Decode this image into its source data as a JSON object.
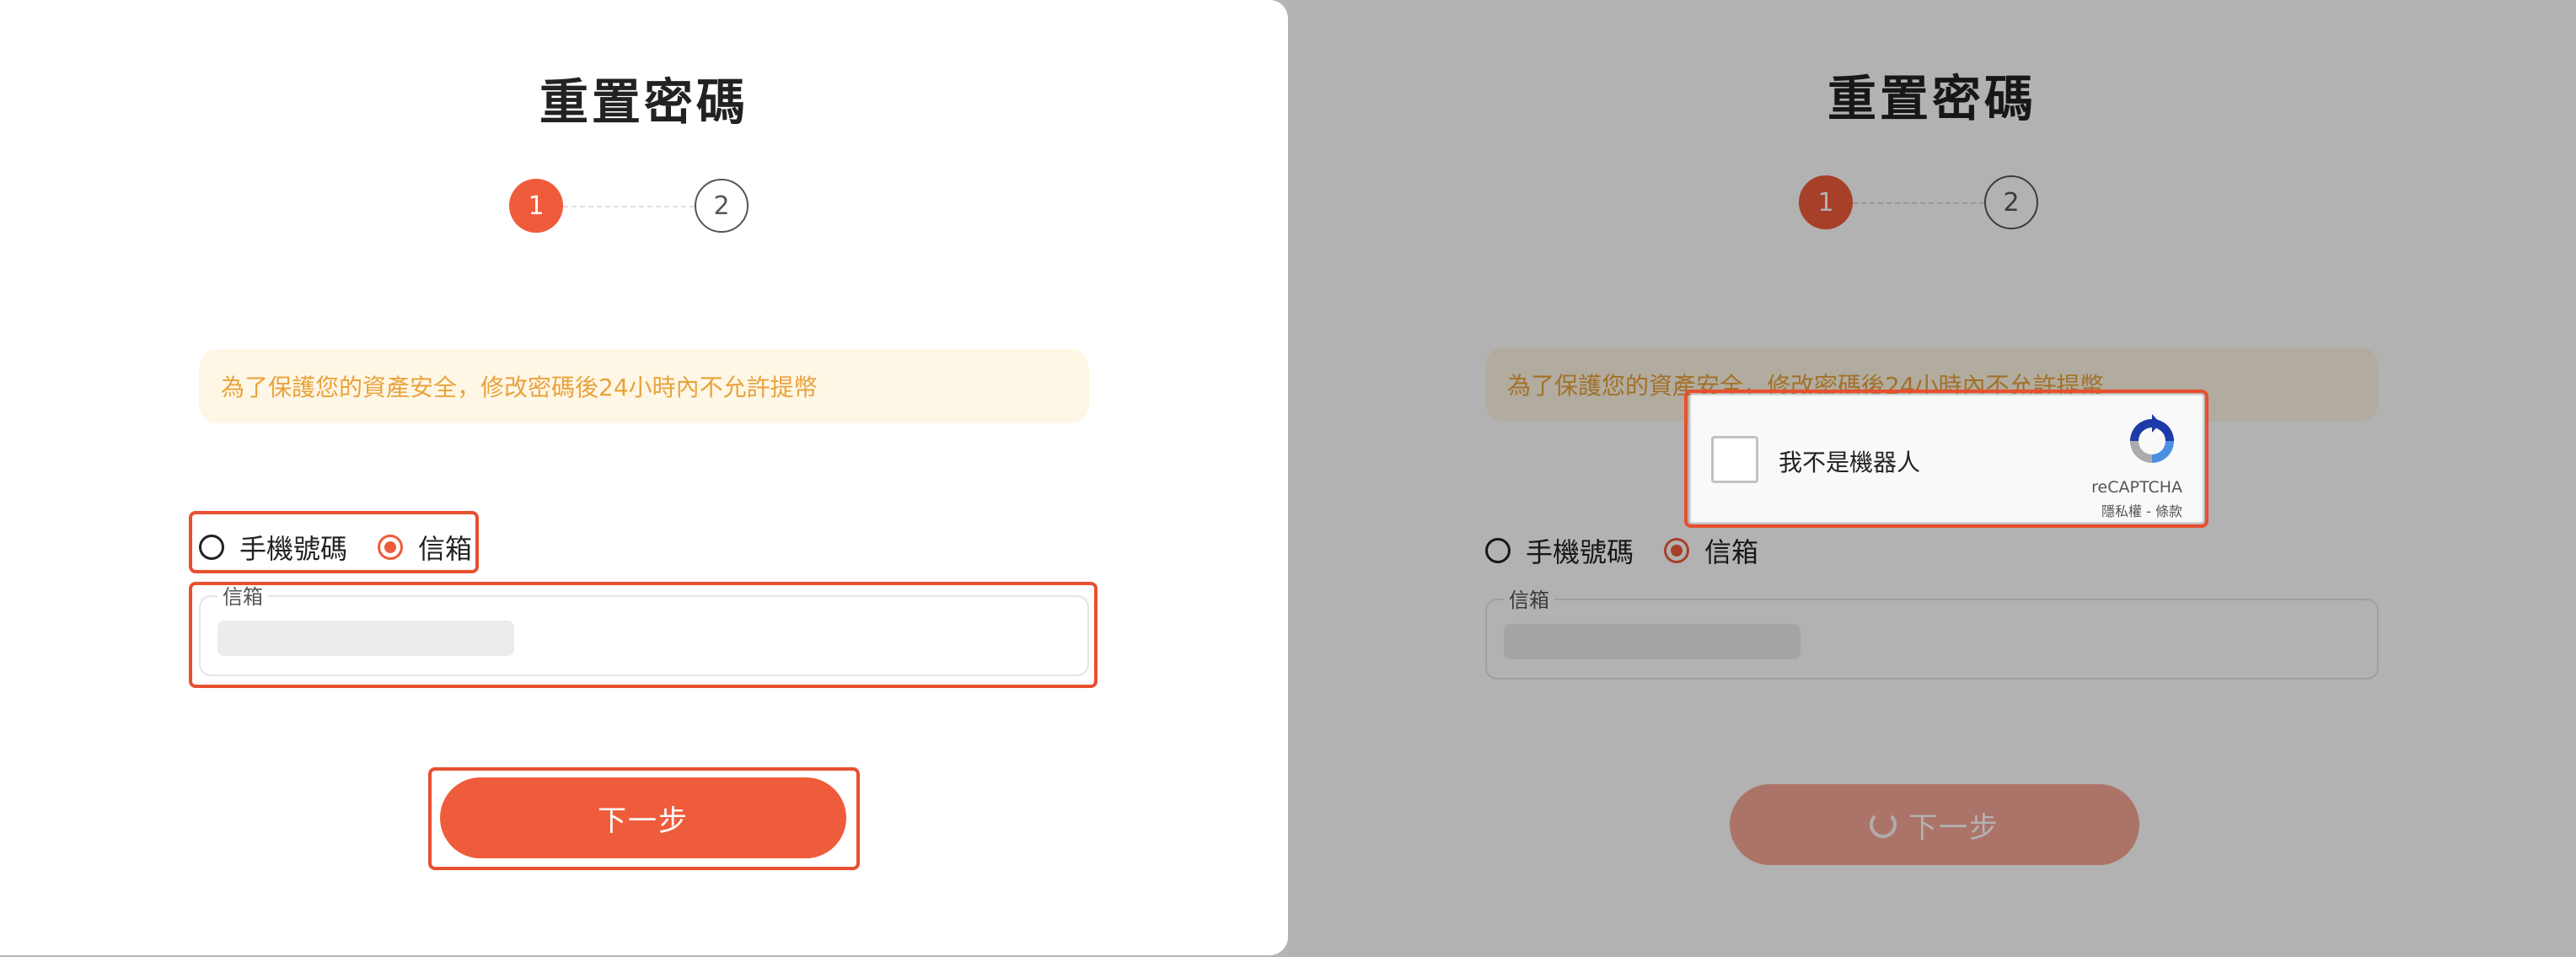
{
  "colors": {
    "accent": "#ef5c3b",
    "accent_disabled": "#f6a795",
    "notice_bg": "#fff7e6",
    "notice_text": "#e9a23b",
    "highlight": "#e8502f"
  },
  "left": {
    "title": "重置密碼",
    "steps": [
      {
        "label": "1",
        "state": "active"
      },
      {
        "label": "2",
        "state": "inactive"
      }
    ],
    "notice": "為了保護您的資產安全，修改密碼後24小時內不允許提幣",
    "radio_options": [
      {
        "label": "手機號碼",
        "checked": false
      },
      {
        "label": "信箱",
        "checked": true
      }
    ],
    "field_label": "信箱",
    "next_button": "下一步"
  },
  "right": {
    "title": "重置密碼",
    "steps": [
      {
        "label": "1",
        "state": "active"
      },
      {
        "label": "2",
        "state": "inactive"
      }
    ],
    "notice": "為了保護您的資產安全，修改密碼後24小時內不允許提幣",
    "radio_options": [
      {
        "label": "手機號碼",
        "checked": false
      },
      {
        "label": "信箱",
        "checked": true
      }
    ],
    "field_label": "信箱",
    "next_button": "下一步",
    "button_state": "loading",
    "recaptcha": {
      "checkbox_label": "我不是機器人",
      "brand": "reCAPTCHA",
      "links": "隱私權 - 條款",
      "logo_icon": "recaptcha-logo-icon"
    }
  }
}
